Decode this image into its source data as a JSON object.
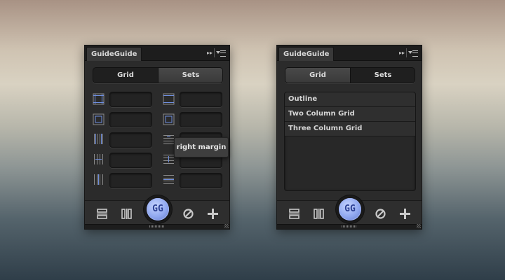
{
  "left_panel": {
    "tab_title": "GuideGuide",
    "panel_controls": {
      "collapse_glyph": "▸▸",
      "menu_icon": "panel-menu-icon"
    },
    "segment": {
      "grid_label": "Grid",
      "sets_label": "Sets",
      "active": "Grid"
    },
    "grid_rows": [
      {
        "left_icon": "margin-outline-icon",
        "right_icon": "margin-outline-icon"
      },
      {
        "left_icon": "margin-inset-icon",
        "right_icon": "margin-inset-icon"
      },
      {
        "left_icon": "columns-icon",
        "right_icon": "rows-icon"
      },
      {
        "left_icon": "column-gutter-icon",
        "right_icon": "row-gutter-icon"
      },
      {
        "left_icon": "column-midpoint-icon",
        "right_icon": "row-midpoint-icon"
      }
    ],
    "tooltip": "right margin",
    "bottom_bar": {
      "gg_label": "GG"
    }
  },
  "right_panel": {
    "tab_title": "GuideGuide",
    "panel_controls": {
      "collapse_glyph": "▸▸",
      "menu_icon": "panel-menu-icon"
    },
    "segment": {
      "grid_label": "Grid",
      "sets_label": "Sets",
      "active": "Grid"
    },
    "sets": [
      {
        "label": "Outline"
      },
      {
        "label": "Two Column Grid"
      },
      {
        "label": "Three Column Grid"
      }
    ],
    "bottom_bar": {
      "gg_label": "GG"
    }
  },
  "colors": {
    "accent_blue": "#8fa7ef",
    "icon_blue": "#6f8fe0",
    "panel_bg": "#2b2b2b"
  }
}
